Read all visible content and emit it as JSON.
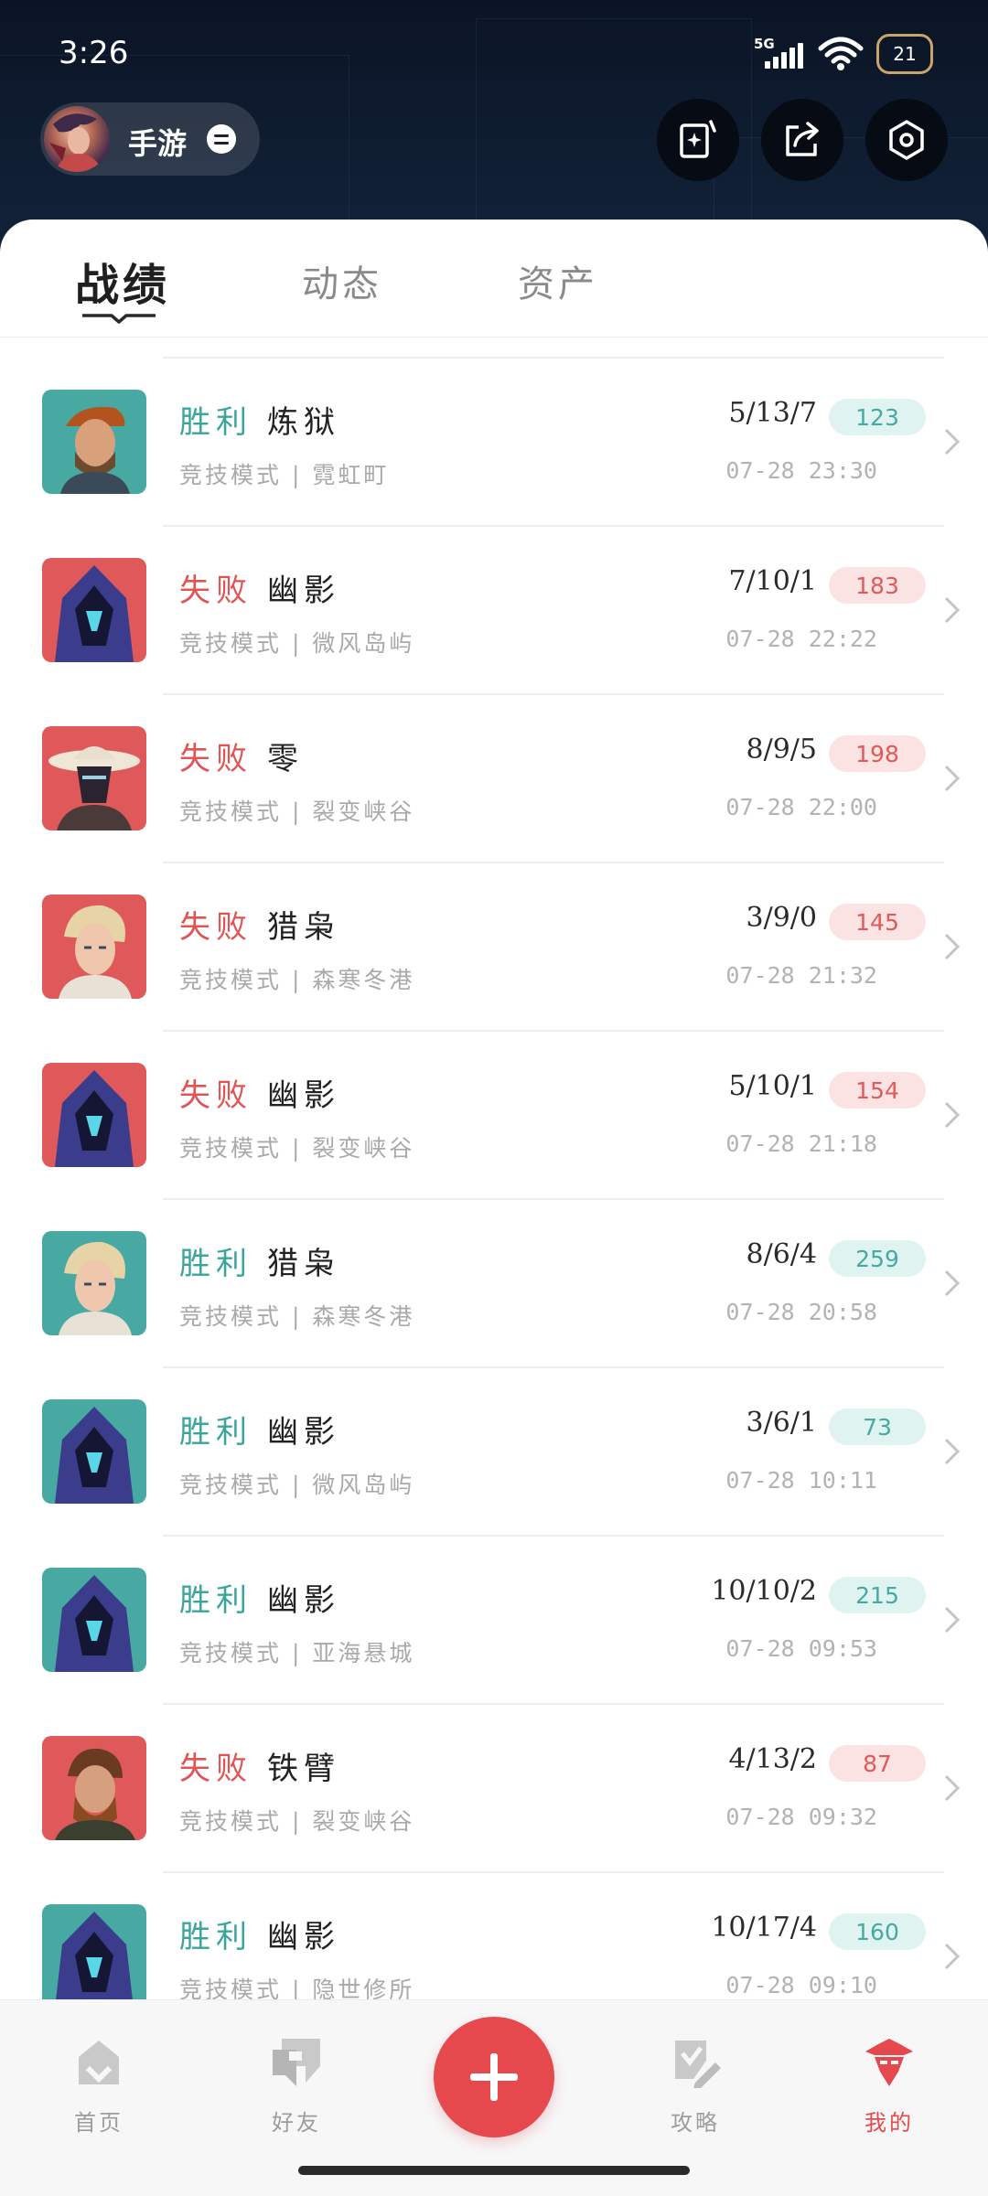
{
  "status_bar": {
    "time": "3:26",
    "network": "5G",
    "battery": "21"
  },
  "header": {
    "account_label": "手游"
  },
  "tabs": [
    {
      "label": "战绩",
      "active": true
    },
    {
      "label": "动态",
      "active": false
    },
    {
      "label": "资产",
      "active": false
    }
  ],
  "matches": [
    {
      "result": "胜利",
      "outcome": "win",
      "hero": "炼狱",
      "mode": "竞技模式 | 霓虹町",
      "kda": "5/13/7",
      "score": "123",
      "time": "07-28 23:30"
    },
    {
      "result": "失败",
      "outcome": "lose",
      "hero": "幽影",
      "mode": "竞技模式 | 微风岛屿",
      "kda": "7/10/1",
      "score": "183",
      "time": "07-28 22:22"
    },
    {
      "result": "失败",
      "outcome": "lose",
      "hero": "零",
      "mode": "竞技模式 | 裂变峡谷",
      "kda": "8/9/5",
      "score": "198",
      "time": "07-28 22:00"
    },
    {
      "result": "失败",
      "outcome": "lose",
      "hero": "猎枭",
      "mode": "竞技模式 | 森寒冬港",
      "kda": "3/9/0",
      "score": "145",
      "time": "07-28 21:32"
    },
    {
      "result": "失败",
      "outcome": "lose",
      "hero": "幽影",
      "mode": "竞技模式 | 裂变峡谷",
      "kda": "5/10/1",
      "score": "154",
      "time": "07-28 21:18"
    },
    {
      "result": "胜利",
      "outcome": "win",
      "hero": "猎枭",
      "mode": "竞技模式 | 森寒冬港",
      "kda": "8/6/4",
      "score": "259",
      "time": "07-28 20:58"
    },
    {
      "result": "胜利",
      "outcome": "win",
      "hero": "幽影",
      "mode": "竞技模式 | 微风岛屿",
      "kda": "3/6/1",
      "score": "73",
      "time": "07-28 10:11"
    },
    {
      "result": "胜利",
      "outcome": "win",
      "hero": "幽影",
      "mode": "竞技模式 | 亚海悬城",
      "kda": "10/10/2",
      "score": "215",
      "time": "07-28 09:53"
    },
    {
      "result": "失败",
      "outcome": "lose",
      "hero": "铁臂",
      "mode": "竞技模式 | 裂变峡谷",
      "kda": "4/13/2",
      "score": "87",
      "time": "07-28 09:32"
    },
    {
      "result": "胜利",
      "outcome": "win",
      "hero": "幽影",
      "mode": "竞技模式 | 隐世修所",
      "kda": "10/17/4",
      "score": "160",
      "time": "07-28 09:10"
    }
  ],
  "bottom_nav": [
    {
      "label": "首页",
      "icon": "home-icon",
      "active": false
    },
    {
      "label": "好友",
      "icon": "friends-icon",
      "active": false
    },
    {
      "label": "攻略",
      "icon": "guide-icon",
      "active": false
    },
    {
      "label": "我的",
      "icon": "profile-icon",
      "active": true
    }
  ],
  "colors": {
    "win": "#3aa69b",
    "lose": "#e05454",
    "accent": "#e5484d",
    "header_bg": "#0f1c30"
  }
}
